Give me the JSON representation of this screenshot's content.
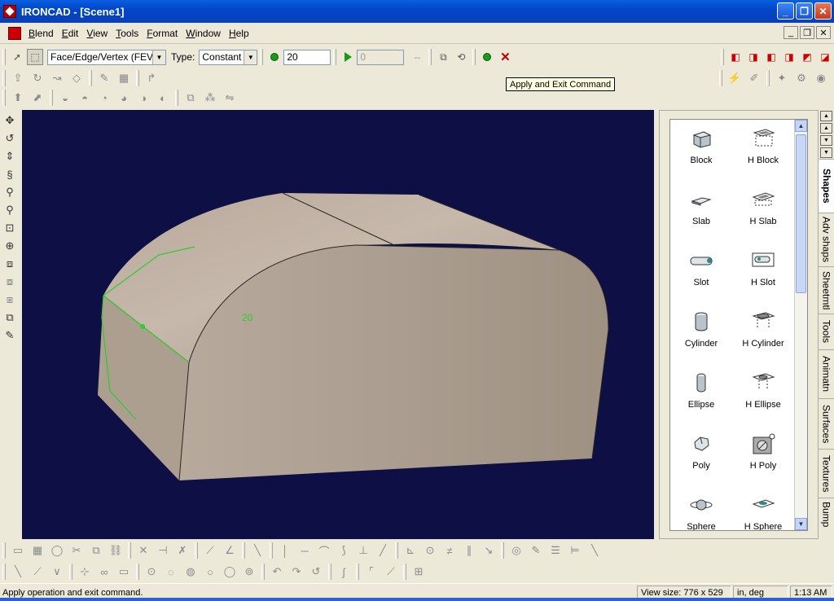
{
  "window": {
    "title": "IRONCAD - [Scene1]",
    "minimize": "_",
    "restore": "❐",
    "close": "✕"
  },
  "menu": [
    "Blend",
    "Edit",
    "View",
    "Tools",
    "Format",
    "Window",
    "Help"
  ],
  "mdi": {
    "minimize": "_",
    "restore": "❐",
    "close": "✕"
  },
  "command": {
    "selection_mode": "Face/Edge/Vertex (FEV)",
    "type_label": "Type:",
    "type_value": "Constant",
    "radius_value": "20",
    "second_value": "0",
    "tooltip": "Apply and Exit Command"
  },
  "viewport": {
    "dimension_label": "20",
    "background": "#0d0f45",
    "part_color": "#a89a8c"
  },
  "catalog": {
    "shapes": [
      {
        "label": "Block",
        "icon": "block-icon"
      },
      {
        "label": "H Block",
        "icon": "hollow-block-icon"
      },
      {
        "label": "Slab",
        "icon": "slab-icon"
      },
      {
        "label": "H Slab",
        "icon": "hollow-slab-icon"
      },
      {
        "label": "Slot",
        "icon": "slot-icon"
      },
      {
        "label": "H Slot",
        "icon": "hollow-slot-icon"
      },
      {
        "label": "Cylinder",
        "icon": "cylinder-icon"
      },
      {
        "label": "H Cylinder",
        "icon": "hollow-cylinder-icon"
      },
      {
        "label": "Ellipse",
        "icon": "ellipse-icon"
      },
      {
        "label": "H Ellipse",
        "icon": "hollow-ellipse-icon"
      },
      {
        "label": "Poly",
        "icon": "poly-icon"
      },
      {
        "label": "H Poly",
        "icon": "hollow-poly-icon"
      },
      {
        "label": "Sphere",
        "icon": "sphere-icon"
      },
      {
        "label": "H Sphere",
        "icon": "hollow-sphere-icon"
      }
    ],
    "tabs": [
      "Shapes",
      "Adv shaps",
      "Sheetmtl",
      "Tools",
      "Animatn",
      "Surfaces",
      "Textures",
      "Bump"
    ]
  },
  "status": {
    "message": "Apply operation and exit command.",
    "view_size": "View size:  776 x  529",
    "units": "in, deg",
    "time": "1:13 AM"
  }
}
